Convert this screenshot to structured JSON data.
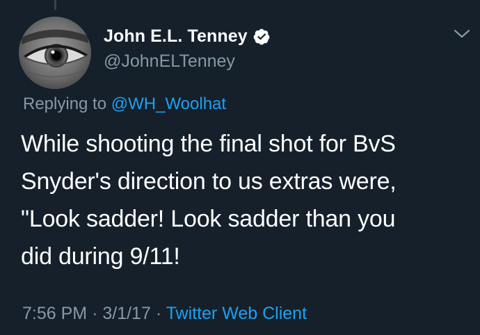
{
  "author": {
    "display_name": "John E.L. Tenney",
    "handle": "@JohnELTenney",
    "verified_icon": "verified-badge-icon",
    "avatar_icon": "eye-avatar"
  },
  "reply": {
    "prefix": "Replying to",
    "mention": "@WH_Woolhat"
  },
  "tweet": {
    "lines": [
      "While shooting the final shot for BvS",
      "Snyder's direction to us extras were,",
      "\"Look sadder! Look sadder than you",
      "did during 9/11!"
    ]
  },
  "meta": {
    "time": "7:56 PM",
    "separator1": "·",
    "date": "3/1/17",
    "separator2": "·",
    "source": "Twitter Web Client"
  },
  "menu_icon": "chevron-down-icon",
  "colors": {
    "background": "#15202b",
    "primary_text": "#ffffff",
    "secondary_text": "#8899a6",
    "link": "#1da1f2",
    "thread_line": "#38444d"
  }
}
